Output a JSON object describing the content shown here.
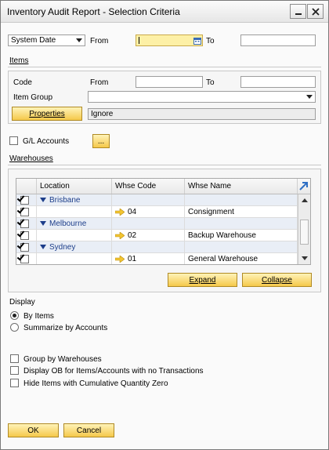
{
  "window": {
    "title": "Inventory Audit Report - Selection Criteria"
  },
  "date_filter": {
    "type_value": "System Date",
    "from_label": "From",
    "from_value": "",
    "to_label": "To",
    "to_value": ""
  },
  "items": {
    "section_label": "Items",
    "code_label": "Code",
    "from_label": "From",
    "to_label": "To",
    "code_from_value": "",
    "code_to_value": "",
    "item_group_label": "Item Group",
    "item_group_value": "",
    "properties_button": "Properties",
    "properties_value": "Ignore"
  },
  "gl_accounts": {
    "label": "G/L Accounts",
    "checked": false,
    "browse_button": "..."
  },
  "warehouses": {
    "section_label": "Warehouses",
    "columns": [
      "Location",
      "Whse Code",
      "Whse Name"
    ],
    "rows": [
      {
        "type": "group",
        "location": "Brisbane",
        "checked": true
      },
      {
        "type": "item",
        "code": "04",
        "name": "Consignment",
        "checked": true
      },
      {
        "type": "group",
        "location": "Melbourne",
        "checked": true
      },
      {
        "type": "item",
        "code": "02",
        "name": "Backup Warehouse",
        "checked": true
      },
      {
        "type": "group",
        "location": "Sydney",
        "checked": true
      },
      {
        "type": "item",
        "code": "01",
        "name": "General Warehouse",
        "checked": true
      }
    ],
    "expand_button": "Expand",
    "collapse_button": "Collapse"
  },
  "display": {
    "label": "Display",
    "options": [
      {
        "label": "By Items",
        "selected": true
      },
      {
        "label": "Summarize by Accounts",
        "selected": false
      }
    ]
  },
  "options": [
    {
      "label": "Group by Warehouses",
      "checked": false
    },
    {
      "label": "Display OB for Items/Accounts with no Transactions",
      "checked": false
    },
    {
      "label": "Hide Items with Cumulative Quantity Zero",
      "checked": false
    }
  ],
  "footer": {
    "ok_button": "OK",
    "cancel_button": "Cancel"
  },
  "colors": {
    "accent_yellow": "#f5c84a",
    "group_text": "#1d3e8a",
    "field_highlight": "#fdf0a6"
  },
  "icons": [
    "minimize-icon",
    "close-icon",
    "calendar-icon",
    "dropdown-arrow-icon",
    "expand-arrow-icon",
    "link-arrow-icon",
    "row-arrow-icon"
  ]
}
